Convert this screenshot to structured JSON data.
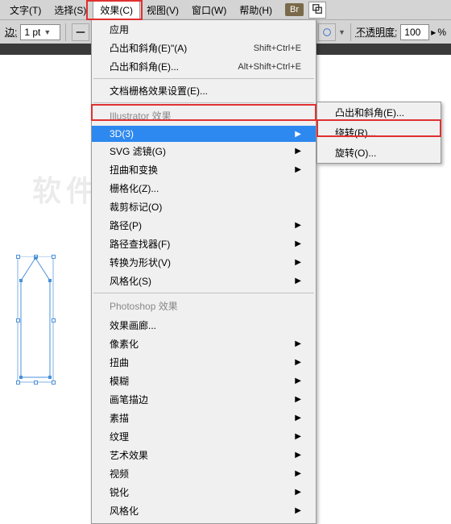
{
  "menubar": {
    "items": [
      "文字(T)",
      "选择(S)",
      "效果(C)",
      "视图(V)",
      "窗口(W)",
      "帮助(H)"
    ],
    "br_badge": "Br"
  },
  "toolbar": {
    "stroke_label": "边:",
    "stroke_value": "1 pt",
    "opacity_label": "不透明度:",
    "opacity_value": "100",
    "opacity_suffix": "%"
  },
  "dropdown": {
    "top_items": [
      {
        "label": "应用",
        "shortcut": "",
        "has_arrow": false
      },
      {
        "label": "凸出和斜角(E)\"(A)",
        "shortcut": "Shift+Ctrl+E",
        "has_arrow": false
      },
      {
        "label": "凸出和斜角(E)...",
        "shortcut": "Alt+Shift+Ctrl+E",
        "has_arrow": false
      }
    ],
    "doc_raster": "文档栅格效果设置(E)...",
    "header1": "Illustrator 效果",
    "ai_items": [
      {
        "label": "3D(3)",
        "has_arrow": true,
        "highlight": true
      },
      {
        "label": "SVG 滤镜(G)",
        "has_arrow": true
      },
      {
        "label": "扭曲和变换",
        "has_arrow": true
      },
      {
        "label": "栅格化(Z)...",
        "has_arrow": false
      },
      {
        "label": "裁剪标记(O)",
        "has_arrow": false
      },
      {
        "label": "路径(P)",
        "has_arrow": true
      },
      {
        "label": "路径查找器(F)",
        "has_arrow": true
      },
      {
        "label": "转换为形状(V)",
        "has_arrow": true
      },
      {
        "label": "风格化(S)",
        "has_arrow": true
      }
    ],
    "header2": "Photoshop 效果",
    "ps_items": [
      {
        "label": "效果画廊...",
        "has_arrow": false
      },
      {
        "label": "像素化",
        "has_arrow": true
      },
      {
        "label": "扭曲",
        "has_arrow": true
      },
      {
        "label": "模糊",
        "has_arrow": true
      },
      {
        "label": "画笔描边",
        "has_arrow": true
      },
      {
        "label": "素描",
        "has_arrow": true
      },
      {
        "label": "纹理",
        "has_arrow": true
      },
      {
        "label": "艺术效果",
        "has_arrow": true
      },
      {
        "label": "视频",
        "has_arrow": true
      },
      {
        "label": "锐化",
        "has_arrow": true
      },
      {
        "label": "风格化",
        "has_arrow": true
      }
    ]
  },
  "submenu": {
    "items": [
      "凸出和斜角(E)...",
      "绕转(R)...",
      "旋转(O)..."
    ]
  },
  "watermark": "软件自学网"
}
